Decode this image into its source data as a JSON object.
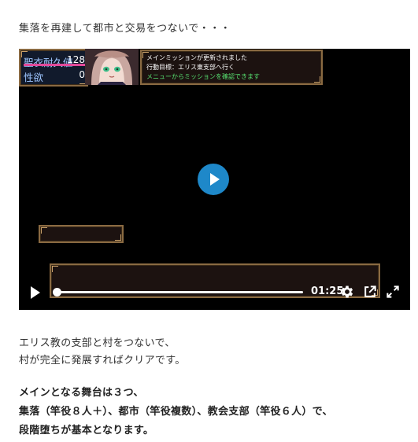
{
  "intro": "集落を再建して都市と交易をつないで・・・",
  "game": {
    "stat1_label": "聖衣耐久値",
    "stat1_value": "128",
    "stat1_level": 1.0,
    "stat2_label": "性欲",
    "stat2_value": "0",
    "stat2_level": 0.0,
    "mission": [
      "メインミッションが更新されました",
      "行動目標：エリス東支部へ行く",
      "メニューからミッションを確認できます"
    ],
    "colors": {
      "mission_highlight": "#57e070",
      "frame": "#8a6a42",
      "play_button": "#1e88c9"
    }
  },
  "controls": {
    "play_icon": "play-icon",
    "time": "01:25",
    "progress": 0.0,
    "icons": [
      "settings-icon",
      "share-icon",
      "fullscreen-icon"
    ]
  },
  "paragraph1": [
    "エリス教の支部と村をつないで、",
    "村が完全に発展すればクリアです。"
  ],
  "paragraph2": [
    "メインとなる舞台は３つ、",
    "集落（竿役８人＋）、都市（竿役複数）、教会支部（竿役６人）で、",
    "段階堕ちが基本となります。"
  ]
}
